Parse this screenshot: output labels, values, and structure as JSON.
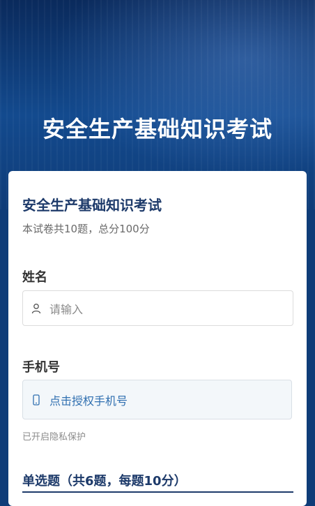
{
  "header": {
    "title": "安全生产基础知识考试"
  },
  "exam": {
    "title": "安全生产基础知识考试",
    "description": "本试卷共10题，总分100分"
  },
  "form": {
    "name": {
      "label": "姓名",
      "placeholder": "请输入",
      "icon": "user-icon"
    },
    "phone": {
      "label": "手机号",
      "button_text": "点击授权手机号",
      "icon": "phone-icon",
      "note": "已开启隐私保护"
    }
  },
  "section": {
    "title": "单选题（共6题，每题10分）"
  },
  "colors": {
    "brand": "#1d3a6a",
    "link": "#2f6fb0",
    "hero": "#0f3c78"
  }
}
